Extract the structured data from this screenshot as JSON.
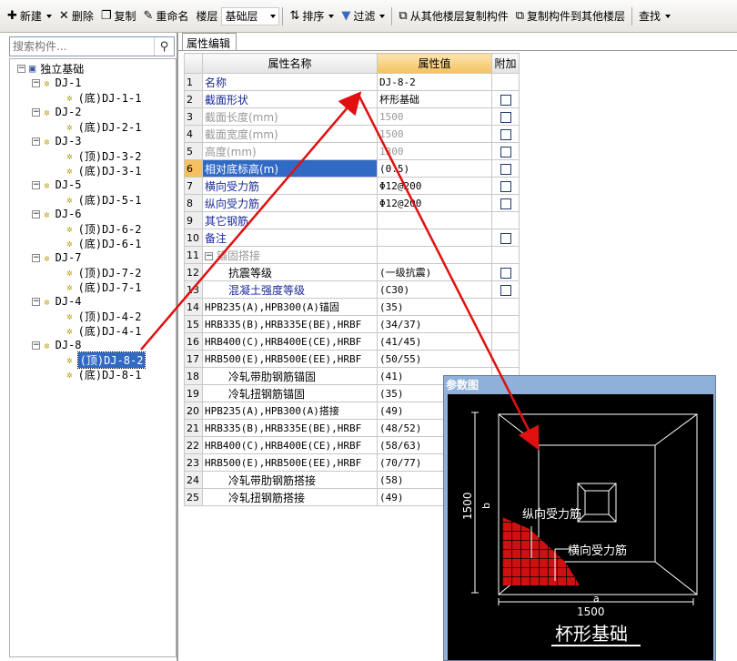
{
  "toolbar": {
    "new": "新建",
    "delete": "删除",
    "copy": "复制",
    "rename": "重命名",
    "floor_label": "楼层",
    "floor_value": "基础层",
    "sort": "排序",
    "filter": "过滤",
    "copy_from": "从其他楼层复制构件",
    "copy_to": "复制构件到其他楼层",
    "find": "查找"
  },
  "search": {
    "placeholder": "搜索构件..."
  },
  "tree": {
    "root": "独立基础",
    "nodes": [
      {
        "label": "DJ-1",
        "children": [
          "(底)DJ-1-1"
        ]
      },
      {
        "label": "DJ-2",
        "children": [
          "(底)DJ-2-1"
        ]
      },
      {
        "label": "DJ-3",
        "children": [
          "(顶)DJ-3-2",
          "(底)DJ-3-1"
        ]
      },
      {
        "label": "DJ-5",
        "children": [
          "(底)DJ-5-1"
        ]
      },
      {
        "label": "DJ-6",
        "children": [
          "(顶)DJ-6-2",
          "(底)DJ-6-1"
        ]
      },
      {
        "label": "DJ-7",
        "children": [
          "(顶)DJ-7-2",
          "(底)DJ-7-1"
        ]
      },
      {
        "label": "DJ-4",
        "children": [
          "(顶)DJ-4-2",
          "(底)DJ-4-1"
        ]
      },
      {
        "label": "DJ-8",
        "children": [
          "(顶)DJ-8-2",
          "(底)DJ-8-1"
        ]
      }
    ],
    "selected": "(顶)DJ-8-2"
  },
  "tab": {
    "label": "属性编辑"
  },
  "grid": {
    "headers": {
      "name": "属性名称",
      "value": "属性值",
      "extra": "附加"
    },
    "rows": [
      {
        "n": "1",
        "name": "名称",
        "value": "DJ-8-2",
        "cb": false,
        "style": "blue"
      },
      {
        "n": "2",
        "name": "截面形状",
        "value": "杯形基础",
        "cb": true,
        "style": "blue"
      },
      {
        "n": "3",
        "name": "截面长度(mm)",
        "value": "1500",
        "cb": true,
        "style": "gray"
      },
      {
        "n": "4",
        "name": "截面宽度(mm)",
        "value": "1500",
        "cb": true,
        "style": "gray"
      },
      {
        "n": "5",
        "name": "高度(mm)",
        "value": "1300",
        "cb": true,
        "style": "gray"
      },
      {
        "n": "6",
        "name": "相对底标高(m)",
        "value": "(0.5)",
        "cb": true,
        "style": "sel"
      },
      {
        "n": "7",
        "name": "横向受力筋",
        "value": "Φ12@200",
        "cb": true,
        "style": "blue"
      },
      {
        "n": "8",
        "name": "纵向受力筋",
        "value": "Φ12@200",
        "cb": true,
        "style": "blue"
      },
      {
        "n": "9",
        "name": "其它钢筋",
        "value": "",
        "cb": false,
        "style": "blue"
      },
      {
        "n": "10",
        "name": "备注",
        "value": "",
        "cb": true,
        "style": "blue"
      },
      {
        "n": "11",
        "name": "锚固搭接",
        "value": "",
        "cb": false,
        "style": "group"
      },
      {
        "n": "12",
        "name": "抗震等级",
        "value": "(一级抗震)",
        "cb": true,
        "style": "indent"
      },
      {
        "n": "13",
        "name": "混凝土强度等级",
        "value": "(C30)",
        "cb": true,
        "style": "indentblue"
      },
      {
        "n": "14",
        "name": "HPB235(A),HPB300(A)锚固",
        "value": "(35)",
        "cb": false,
        "style": "sub"
      },
      {
        "n": "15",
        "name": "HRB335(B),HRB335E(BE),HRBF",
        "value": "(34/37)",
        "cb": false,
        "style": "sub"
      },
      {
        "n": "16",
        "name": "HRB400(C),HRB400E(CE),HRBF",
        "value": "(41/45)",
        "cb": false,
        "style": "sub"
      },
      {
        "n": "17",
        "name": "HRB500(E),HRB500E(EE),HRBF",
        "value": "(50/55)",
        "cb": false,
        "style": "sub"
      },
      {
        "n": "18",
        "name": "冷轧带肋钢筋锚固",
        "value": "(41)",
        "cb": false,
        "style": "indent"
      },
      {
        "n": "19",
        "name": "冷轧扭钢筋锚固",
        "value": "(35)",
        "cb": false,
        "style": "indent"
      },
      {
        "n": "20",
        "name": "HPB235(A),HPB300(A)搭接",
        "value": "(49)",
        "cb": false,
        "style": "sub"
      },
      {
        "n": "21",
        "name": "HRB335(B),HRB335E(BE),HRBF",
        "value": "(48/52)",
        "cb": false,
        "style": "sub"
      },
      {
        "n": "22",
        "name": "HRB400(C),HRB400E(CE),HRBF",
        "value": "(58/63)",
        "cb": false,
        "style": "sub"
      },
      {
        "n": "23",
        "name": "HRB500(E),HRB500E(EE),HRBF",
        "value": "(70/77)",
        "cb": false,
        "style": "sub"
      },
      {
        "n": "24",
        "name": "冷轧带肋钢筋搭接",
        "value": "(58)",
        "cb": false,
        "style": "indent"
      },
      {
        "n": "25",
        "name": "冷轧扭钢筋搭接",
        "value": "(49)",
        "cb": false,
        "style": "indent"
      }
    ]
  },
  "param_panel": {
    "title": "参数图",
    "dim_h": "1500",
    "dim_b": "b",
    "dim_w": "1500",
    "dim_a": "a",
    "label_long": "纵向受力筋",
    "label_trans": "横向受力筋",
    "caption": "杯形基础"
  },
  "colors": {
    "selection": "#316ac5",
    "value_header": "#f5c060",
    "arrow": "#e01010"
  }
}
